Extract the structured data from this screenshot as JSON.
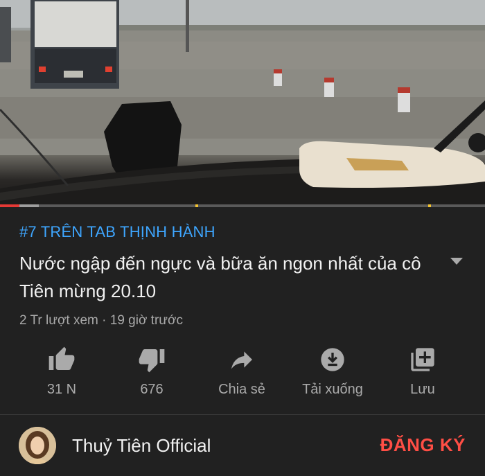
{
  "video": {
    "progress_played": 0.04,
    "progress_buffered": 0.08
  },
  "trending_label": "#7 TRÊN TAB THỊNH HÀNH",
  "title": "Nước ngập đến ngực và bữa ăn ngon nhất của cô Tiên mừng 20.10",
  "meta": "2 Tr lượt xem · 19 giờ trước",
  "actions": [
    {
      "icon": "thumbs-up-icon",
      "label": "31 N"
    },
    {
      "icon": "thumbs-down-icon",
      "label": "676"
    },
    {
      "icon": "share-icon",
      "label": "Chia sẻ"
    },
    {
      "icon": "download-icon",
      "label": "Tải xuống"
    },
    {
      "icon": "save-playlist-icon",
      "label": "Lưu"
    }
  ],
  "channel": {
    "name": "Thuỷ Tiên Official",
    "subscribe_label": "ĐĂNG KÝ"
  },
  "colors": {
    "background": "#212121",
    "trending": "#3ea6ff",
    "subscribe": "#ff4e45",
    "progress": "#e53935"
  }
}
